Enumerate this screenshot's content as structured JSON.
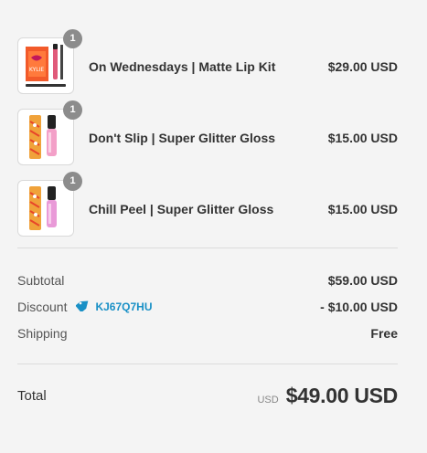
{
  "items": [
    {
      "name": "On Wednesdays | Matte Lip Kit",
      "price": "$29.00 USD",
      "quantity": "1",
      "thumbnail": "lip-kit-product-icon"
    },
    {
      "name": "Don't Slip | Super Glitter Gloss",
      "price": "$15.00 USD",
      "quantity": "1",
      "thumbnail": "glitter-gloss-product-icon"
    },
    {
      "name": "Chill Peel | Super Glitter Gloss",
      "price": "$15.00 USD",
      "quantity": "1",
      "thumbnail": "glitter-gloss-product-icon"
    }
  ],
  "summary": {
    "subtotal_label": "Subtotal",
    "subtotal_value": "$59.00 USD",
    "discount_label": "Discount",
    "discount_code": "KJ67Q7HU",
    "discount_value": "- $10.00 USD",
    "shipping_label": "Shipping",
    "shipping_value": "Free"
  },
  "total": {
    "label": "Total",
    "currency": "USD",
    "amount": "$49.00 USD"
  },
  "colors": {
    "background": "#f4f4f4",
    "text": "#333333",
    "badge": "#8c8c8c",
    "discount_code": "#1990c6"
  }
}
